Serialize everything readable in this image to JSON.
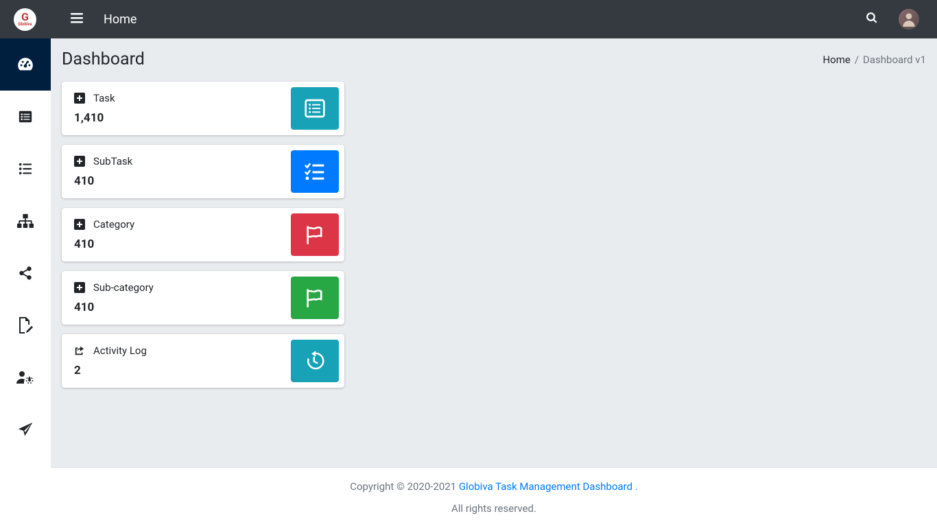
{
  "header": {
    "title": "Home"
  },
  "page": {
    "title": "Dashboard"
  },
  "breadcrumb": {
    "home": "Home",
    "current": "Dashboard v1"
  },
  "cards": {
    "task": {
      "label": "Task",
      "value": "1,410"
    },
    "subtask": {
      "label": "SubTask",
      "value": "410"
    },
    "category": {
      "label": "Category",
      "value": "410"
    },
    "subcategory": {
      "label": "Sub-category",
      "value": "410"
    },
    "activity": {
      "label": "Activity Log",
      "value": "2"
    }
  },
  "footer": {
    "copyright_prefix": "Copyright © 2020-2021 ",
    "link": "Globiva Task Management Dashboard",
    "suffix": " .",
    "rights": "All rights reserved."
  }
}
